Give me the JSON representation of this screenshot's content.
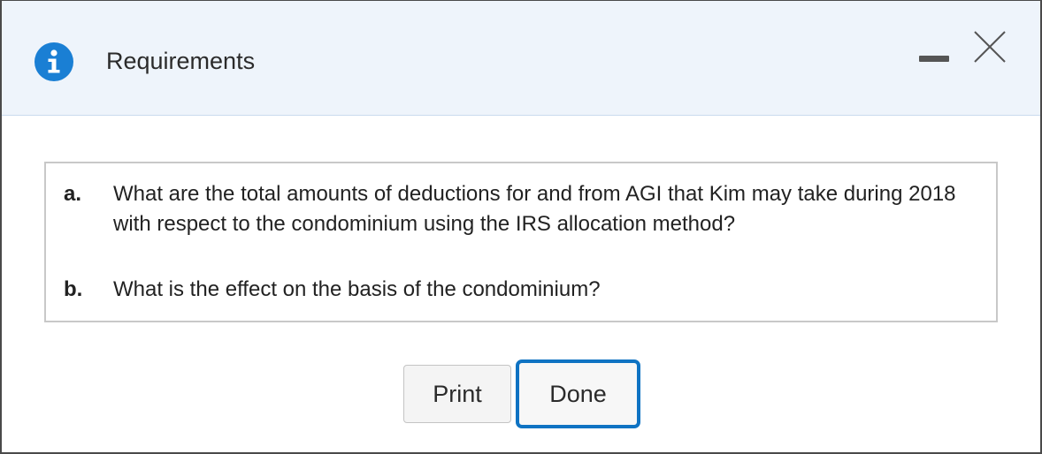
{
  "dialog": {
    "title": "Requirements",
    "icons": {
      "info": "info-icon",
      "minimize": "minimize-icon",
      "close": "close-icon"
    },
    "colors": {
      "accent": "#1a7fd4",
      "titlebar_bg": "#eef4fb",
      "done_border": "#0f73c3"
    }
  },
  "requirements": [
    {
      "letter": "a.",
      "text": "What are the total amounts of deductions for and from AGI that Kim may take during 2018 with respect to the condominium using the IRS allocation method?"
    },
    {
      "letter": "b.",
      "text": "What is the effect on the basis of the condominium?"
    }
  ],
  "buttons": {
    "print_label": "Print",
    "done_label": "Done"
  }
}
